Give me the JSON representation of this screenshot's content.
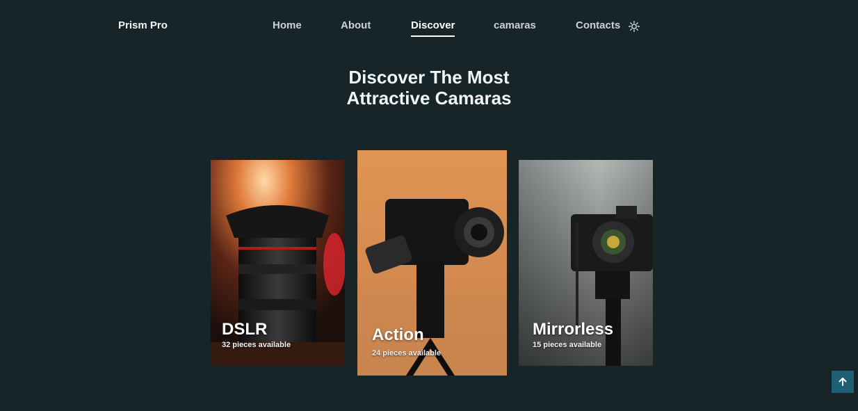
{
  "brand": "Prism Pro",
  "nav": {
    "items": [
      {
        "label": "Home"
      },
      {
        "label": "About"
      },
      {
        "label": "Discover"
      },
      {
        "label": "camaras"
      },
      {
        "label": "Contacts"
      }
    ],
    "active": "Discover",
    "theme_icon": "sun-icon"
  },
  "hero": {
    "line1": "Discover The Most",
    "line2": "Attractive Camaras"
  },
  "cards": [
    {
      "title": "DSLR",
      "subtitle": "32 pieces available"
    },
    {
      "title": "Action",
      "subtitle": "24 pieces available"
    },
    {
      "title": "Mirrorless",
      "subtitle": "15 pieces available"
    }
  ],
  "scroll_top_icon": "arrow-up-icon",
  "colors": {
    "background": "#172529",
    "accent": "#1e5f73"
  }
}
